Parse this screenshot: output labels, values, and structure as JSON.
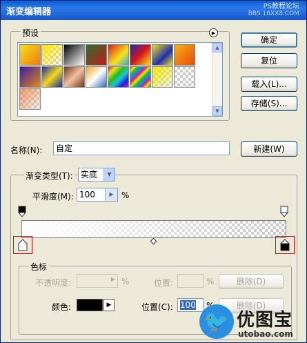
{
  "window": {
    "title": "渐变编辑器",
    "watermark_line1": "PS教程论坛",
    "watermark_line2": "BBS.16XX8.COM"
  },
  "presets": {
    "label": "预设",
    "menu_icon": "circle-arrow-right-icon"
  },
  "buttons": {
    "ok": "确定",
    "reset": "复位",
    "load": "载入(L)...",
    "save": "存储(S)...",
    "new": "新建(W)"
  },
  "name_field": {
    "label": "名称(N):",
    "value": "自定"
  },
  "gradient": {
    "type_label": "渐变类型(T):",
    "type_value": "实底",
    "smoothness_label": "平滑度(M):",
    "smoothness_value": "100",
    "smoothness_unit": "%"
  },
  "stops": {
    "group_label": "色标",
    "opacity_label": "不透明度:",
    "opacity_unit": "%",
    "opacity_location_label": "位置:",
    "opacity_location_unit": "%",
    "delete_label": "删除(D)",
    "color_label": "颜色:",
    "color_value": "#000000",
    "color_location_label": "位置(C):",
    "color_location_value": "100",
    "color_location_unit": "%",
    "delete_label_2": "删除(D)"
  },
  "logo": {
    "text": "优图宝",
    "url": "utobao.com"
  }
}
